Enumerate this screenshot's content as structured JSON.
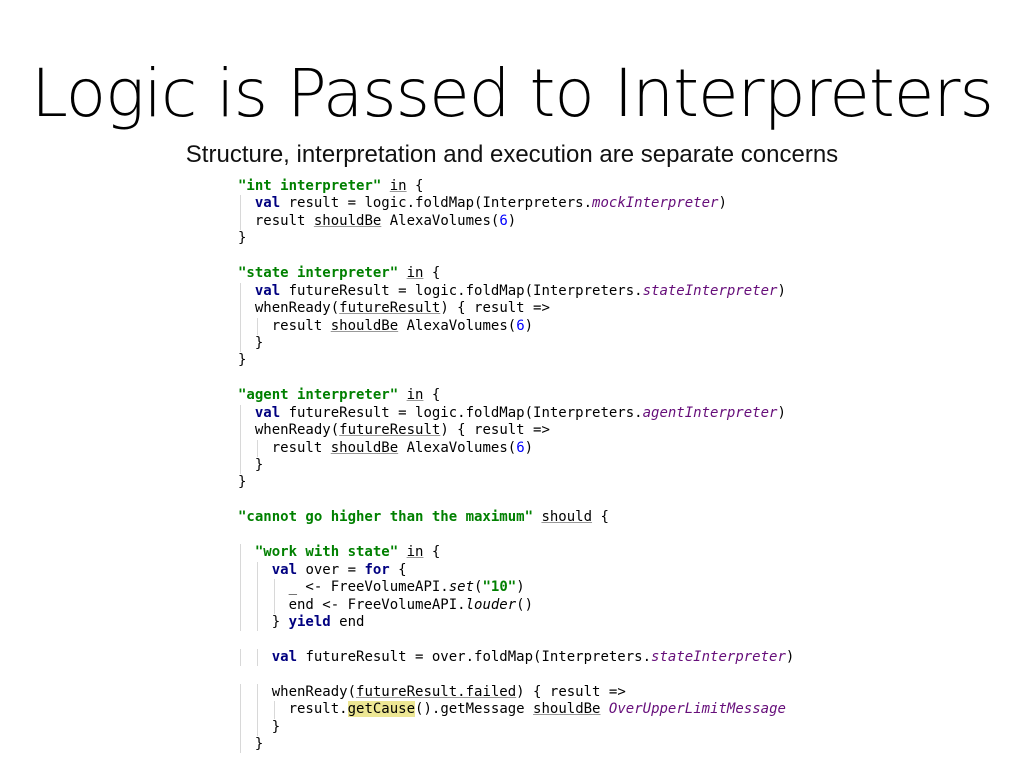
{
  "slide": {
    "title": "Logic is Passed to Interpreters",
    "subtitle": "Structure, interpretation and execution are separate concerns"
  },
  "code": {
    "lines": [
      {
        "indent": 0,
        "segments": [
          {
            "t": "\"int interpreter\"",
            "c": "str"
          },
          {
            "t": " "
          },
          {
            "t": "in",
            "c": "ul"
          },
          {
            "t": " {"
          }
        ]
      },
      {
        "indent": 1,
        "segments": [
          {
            "t": "val",
            "c": "kw"
          },
          {
            "t": " result = logic.foldMap(Interpreters."
          },
          {
            "t": "mockInterpreter",
            "c": "it"
          },
          {
            "t": ")"
          }
        ]
      },
      {
        "indent": 1,
        "segments": [
          {
            "t": "result "
          },
          {
            "t": "shouldBe",
            "c": "ul"
          },
          {
            "t": " AlexaVolumes("
          },
          {
            "t": "6",
            "c": "num"
          },
          {
            "t": ")"
          }
        ]
      },
      {
        "indent": 0,
        "segments": [
          {
            "t": "}"
          }
        ]
      },
      {
        "indent": 0,
        "segments": []
      },
      {
        "indent": 0,
        "segments": [
          {
            "t": "\"state interpreter\"",
            "c": "str"
          },
          {
            "t": " "
          },
          {
            "t": "in",
            "c": "ul"
          },
          {
            "t": " {"
          }
        ]
      },
      {
        "indent": 1,
        "segments": [
          {
            "t": "val",
            "c": "kw"
          },
          {
            "t": " futureResult = logic.foldMap(Interpreters."
          },
          {
            "t": "stateInterpreter",
            "c": "it"
          },
          {
            "t": ")"
          }
        ]
      },
      {
        "indent": 1,
        "segments": [
          {
            "t": "whenReady("
          },
          {
            "t": "futureResult",
            "c": "ul"
          },
          {
            "t": ") { result =>"
          }
        ]
      },
      {
        "indent": 2,
        "segments": [
          {
            "t": "result "
          },
          {
            "t": "shouldBe",
            "c": "ul"
          },
          {
            "t": " AlexaVolumes("
          },
          {
            "t": "6",
            "c": "num"
          },
          {
            "t": ")"
          }
        ]
      },
      {
        "indent": 1,
        "segments": [
          {
            "t": "}"
          }
        ]
      },
      {
        "indent": 0,
        "segments": [
          {
            "t": "}"
          }
        ]
      },
      {
        "indent": 0,
        "segments": []
      },
      {
        "indent": 0,
        "segments": [
          {
            "t": "\"agent interpreter\"",
            "c": "str"
          },
          {
            "t": " "
          },
          {
            "t": "in",
            "c": "ul"
          },
          {
            "t": " {"
          }
        ]
      },
      {
        "indent": 1,
        "segments": [
          {
            "t": "val",
            "c": "kw"
          },
          {
            "t": " futureResult = logic.foldMap(Interpreters."
          },
          {
            "t": "agentInterpreter",
            "c": "it"
          },
          {
            "t": ")"
          }
        ]
      },
      {
        "indent": 1,
        "segments": [
          {
            "t": "whenReady("
          },
          {
            "t": "futureResult",
            "c": "ul"
          },
          {
            "t": ") { result =>"
          }
        ]
      },
      {
        "indent": 2,
        "segments": [
          {
            "t": "result "
          },
          {
            "t": "shouldBe",
            "c": "ul"
          },
          {
            "t": " AlexaVolumes("
          },
          {
            "t": "6",
            "c": "num"
          },
          {
            "t": ")"
          }
        ]
      },
      {
        "indent": 1,
        "segments": [
          {
            "t": "}"
          }
        ]
      },
      {
        "indent": 0,
        "segments": [
          {
            "t": "}"
          }
        ]
      },
      {
        "indent": 0,
        "segments": []
      },
      {
        "indent": 0,
        "segments": [
          {
            "t": "\"cannot go higher than the maximum\"",
            "c": "str"
          },
          {
            "t": " "
          },
          {
            "t": "should",
            "c": "ul"
          },
          {
            "t": " {"
          }
        ]
      },
      {
        "indent": 0,
        "segments": []
      },
      {
        "indent": 1,
        "segments": [
          {
            "t": "\"work with state\"",
            "c": "str"
          },
          {
            "t": " "
          },
          {
            "t": "in",
            "c": "ul"
          },
          {
            "t": " {"
          }
        ]
      },
      {
        "indent": 2,
        "segments": [
          {
            "t": "val",
            "c": "kw"
          },
          {
            "t": " over = "
          },
          {
            "t": "for",
            "c": "kw"
          },
          {
            "t": " {"
          }
        ]
      },
      {
        "indent": 3,
        "segments": [
          {
            "t": "_ <- FreeVolumeAPI."
          },
          {
            "t": "set",
            "c": "its"
          },
          {
            "t": "("
          },
          {
            "t": "\"10\"",
            "c": "str"
          },
          {
            "t": ")"
          }
        ]
      },
      {
        "indent": 3,
        "segments": [
          {
            "t": "end <- FreeVolumeAPI."
          },
          {
            "t": "louder",
            "c": "its"
          },
          {
            "t": "()"
          }
        ]
      },
      {
        "indent": 2,
        "segments": [
          {
            "t": "} "
          },
          {
            "t": "yield",
            "c": "kw"
          },
          {
            "t": " end"
          }
        ]
      },
      {
        "indent": 0,
        "segments": []
      },
      {
        "indent": 2,
        "segments": [
          {
            "t": "val",
            "c": "kw"
          },
          {
            "t": " futureResult = over.foldMap(Interpreters."
          },
          {
            "t": "stateInterpreter",
            "c": "it"
          },
          {
            "t": ")"
          }
        ]
      },
      {
        "indent": 0,
        "segments": []
      },
      {
        "indent": 2,
        "segments": [
          {
            "t": "whenReady("
          },
          {
            "t": "futureResult.failed",
            "c": "ul"
          },
          {
            "t": ") { result =>"
          }
        ]
      },
      {
        "indent": 3,
        "segments": [
          {
            "t": "result."
          },
          {
            "t": "getCause",
            "c": "hl"
          },
          {
            "t": "().getMessage "
          },
          {
            "t": "shouldBe",
            "c": "ul"
          },
          {
            "t": " "
          },
          {
            "t": "OverUpperLimitMessage",
            "c": "it"
          }
        ]
      },
      {
        "indent": 2,
        "segments": [
          {
            "t": "}"
          }
        ]
      },
      {
        "indent": 1,
        "segments": [
          {
            "t": "}"
          }
        ]
      }
    ]
  }
}
